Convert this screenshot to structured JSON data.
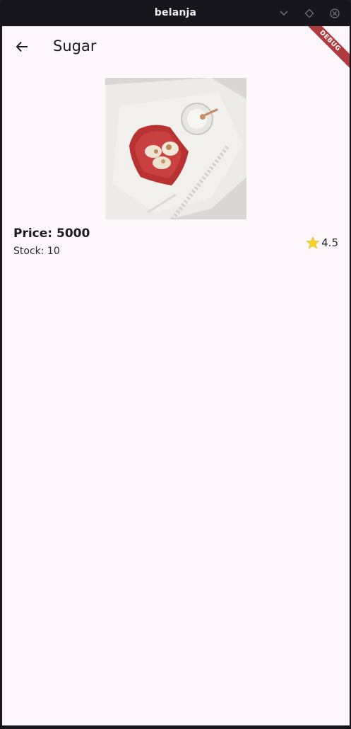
{
  "window": {
    "title": "belanja"
  },
  "appbar": {
    "title": "Sugar",
    "back_icon": "arrow-back-icon"
  },
  "debug_banner": "DEBUG",
  "product": {
    "image_alt": "sugar-product-image",
    "price_text": "Price: 5000",
    "stock_text": "Stock: 10",
    "rating": "4.5",
    "rating_icon": "star-icon"
  },
  "colors": {
    "background": "#fdf7fc",
    "titlebar": "#16161c",
    "debug": "#b03a3e",
    "star": "#f5d327"
  }
}
